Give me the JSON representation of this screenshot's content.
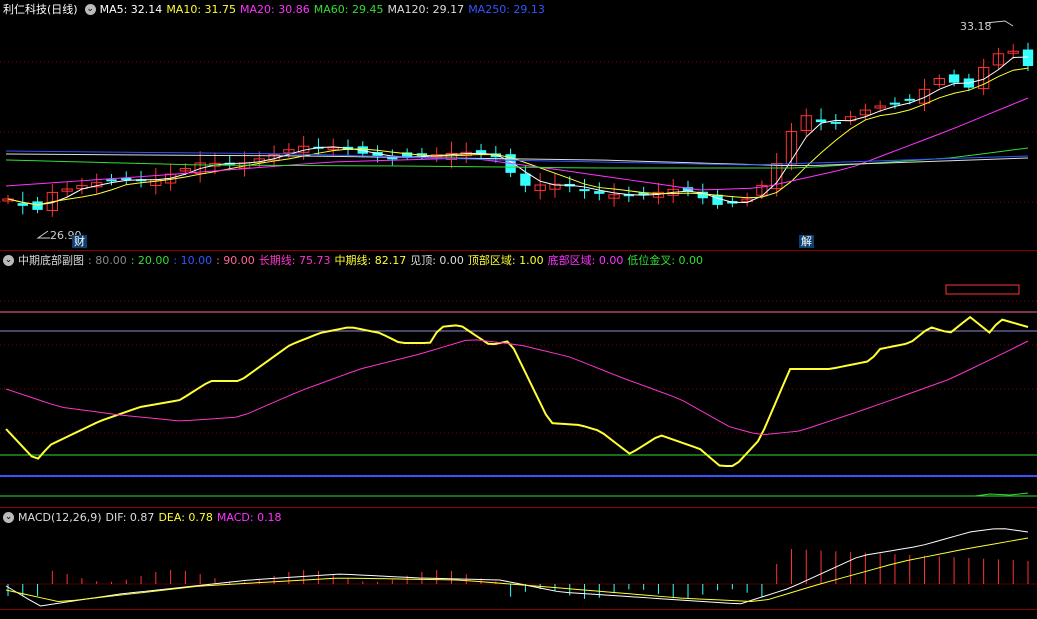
{
  "main": {
    "title": "利仁科技(日线)",
    "ma": [
      {
        "label": "MA5: 32.14",
        "color": "#ffffff"
      },
      {
        "label": "MA10: 31.75",
        "color": "#ffff33"
      },
      {
        "label": "MA20: 30.86",
        "color": "#ff33ff"
      },
      {
        "label": "MA60: 29.45",
        "color": "#33dd33"
      },
      {
        "label": "MA120: 29.17",
        "color": "#dddddd"
      },
      {
        "label": "MA250: 29.13",
        "color": "#3355ff"
      }
    ],
    "high_label": "33.18",
    "low_label": "26.90",
    "tag_cai": "财",
    "tag_jie": "解"
  },
  "indicator": {
    "title": "中期底部副图",
    "items": [
      {
        "label": ": 80.00",
        "color": "#888888"
      },
      {
        "label": ": 20.00",
        "color": "#33dd33"
      },
      {
        "label": ": 10.00",
        "color": "#3355ff"
      },
      {
        "label": ": 90.00",
        "color": "#ff6699"
      },
      {
        "label": "长期线: 75.73",
        "color": "#ff33cc"
      },
      {
        "label": "中期线: 82.17",
        "color": "#ffff33"
      },
      {
        "label": "见顶: 0.00",
        "color": "#dddddd"
      },
      {
        "label": "顶部区域: 1.00",
        "color": "#ffff33"
      },
      {
        "label": "底部区域: 0.00",
        "color": "#ff33ff"
      },
      {
        "label": "低位金叉: 0.00",
        "color": "#33dd33"
      }
    ]
  },
  "macd": {
    "title": "MACD(12,26,9)",
    "items": [
      {
        "label": "DIF: 0.87",
        "color": "#dddddd"
      },
      {
        "label": "DEA: 0.78",
        "color": "#ffff33"
      },
      {
        "label": "MACD: 0.18",
        "color": "#ff33ff"
      }
    ]
  },
  "colors": {
    "up": "#ff3333",
    "down": "#33ffff",
    "grid": "#8a0000",
    "bg": "#000000"
  }
}
